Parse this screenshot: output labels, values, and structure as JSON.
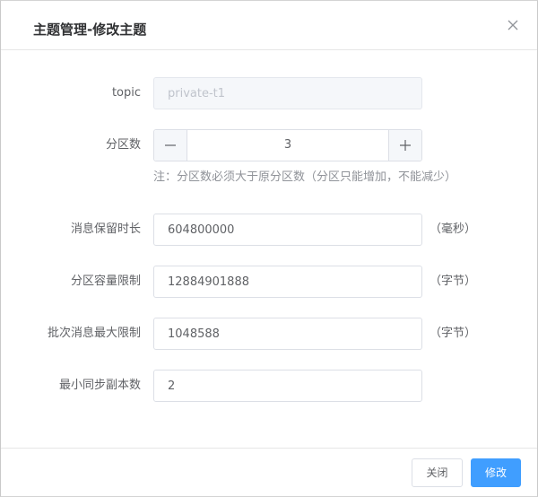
{
  "dialog": {
    "title": "主题管理-修改主题",
    "close_icon": "close-icon"
  },
  "form": {
    "topic": {
      "label": "topic",
      "value": "private-t1",
      "disabled": true
    },
    "partitions": {
      "label": "分区数",
      "value": "3",
      "minus_icon": "minus-icon",
      "plus_icon": "plus-icon",
      "hint": "注：分区数必须大于原分区数（分区只能增加，不能减少）"
    },
    "retention": {
      "label": "消息保留时长",
      "value": "604800000",
      "unit": "（毫秒）"
    },
    "partition_capacity": {
      "label": "分区容量限制",
      "value": "12884901888",
      "unit": "（字节）"
    },
    "batch_limit": {
      "label": "批次消息最大限制",
      "value": "1048588",
      "unit": "（字节）"
    },
    "min_isr": {
      "label": "最小同步副本数",
      "value": "2"
    }
  },
  "footer": {
    "cancel_label": "关闭",
    "submit_label": "修改"
  },
  "colors": {
    "primary": "#409eff",
    "border": "#dcdfe6",
    "disabled_bg": "#f5f7fa"
  }
}
